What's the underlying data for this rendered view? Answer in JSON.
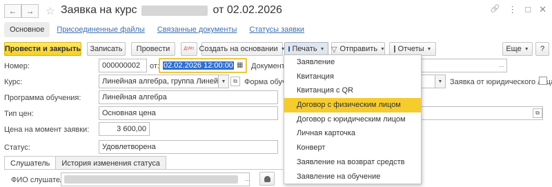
{
  "window": {
    "title_prefix": "Заявка на курс",
    "title_suffix": "от 02.02.2026",
    "back_glyph": "←",
    "forward_glyph": "→",
    "star_glyph": "☆",
    "link_glyph": "🔗",
    "more_glyph": "⋮",
    "max_glyph": "□",
    "close_glyph": "✕"
  },
  "tabs": [
    {
      "label": "Основное"
    },
    {
      "label": "Присоединенные файлы"
    },
    {
      "label": "Связанные документы"
    },
    {
      "label": "Статусы заявки"
    }
  ],
  "toolbar": {
    "post_close": "Провести и закрыть",
    "write": "Записать",
    "post": "Провести",
    "dtkt_icon": "Дт/Кт",
    "create_based": "Создать на основании",
    "print": "Печать",
    "send": "Отправить",
    "reports": "Отчеты",
    "more": "Еще",
    "help": "?"
  },
  "form": {
    "number_label": "Номер:",
    "number_value": "000000002",
    "from_label": "от:",
    "date_value": "02.02.2026 12:00:00",
    "doc_label": "Документ ос",
    "course_label": "Курс:",
    "course_value": "Линейная алгебра, группа Линейная алгебр",
    "form_label": "Форма обучен",
    "legal_label": "Заявка от юридического лица:",
    "program_label": "Программа обучения:",
    "program_value": "Линейная алгебра",
    "price_type_label": "Тип цен:",
    "price_type_value": "Основная цена",
    "price_label": "Цена на момент заявки:",
    "price_value": "3 600,00",
    "status_label": "Статус:",
    "status_value": "Удовлетворена"
  },
  "subtabs": [
    {
      "label": "Слушатель"
    },
    {
      "label": "История изменения статуса"
    }
  ],
  "listener": {
    "fio_label": "ФИО слушателя:"
  },
  "print_menu": {
    "items": [
      "Заявление",
      "Квитанция",
      "Квитанция с QR",
      "Договор с физическим лицом",
      "Договор с юридическим лицом",
      "Личная карточка",
      "Конверт",
      "Заявление на возврат средств",
      "Заявление на обучение"
    ],
    "highlighted_index": 3
  },
  "colors": {
    "accent_yellow": "#f6cc2d",
    "link_blue": "#3a6fb1",
    "selection_blue": "#2f6fd1"
  }
}
